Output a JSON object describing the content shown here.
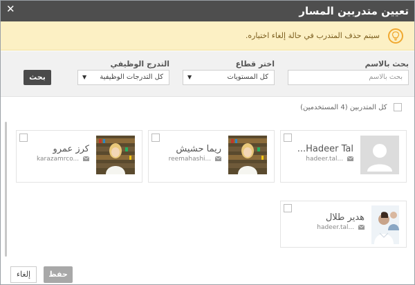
{
  "dialog": {
    "title": "تعيين متدربين المسار",
    "close_glyph": "✕"
  },
  "warning": {
    "icon": "lightbulb-icon",
    "message": "سيتم حذف المتدرب في حالة إلغاء اختياره."
  },
  "filters": {
    "name_search": {
      "label": "بحث بالاسم",
      "placeholder": "بحث بالاسم"
    },
    "sector": {
      "label": "اختر قطاع",
      "selected": "كل المستويات"
    },
    "grade": {
      "label": "التدرج الوظيفي",
      "selected": "كل التدرجات الوظيفية"
    },
    "search_button": "بحث"
  },
  "select_all": {
    "label": "كل المتدربين (4 المستخدمين)"
  },
  "trainees": [
    {
      "name": "Hadeer Tal...",
      "email": "hadeer.tal...",
      "photo": "placeholder-avatar"
    },
    {
      "name": "ريما حشيش",
      "email": "reemahashi...",
      "photo": "library-photo"
    },
    {
      "name": "كرز عمرو",
      "email": "karazamrco...",
      "photo": "library-photo"
    },
    {
      "name": "هدير طلال",
      "email": "hadeer.tal...",
      "photo": "person-photo"
    }
  ],
  "footer": {
    "save_label": "حفظ",
    "cancel_label": "إلغاء"
  },
  "colors": {
    "titlebar": "#4e4e4e",
    "warning_bg": "#fcf0c4",
    "filter_bg": "#f1f1f1",
    "search_btn": "#4a4a4a",
    "save_btn": "#a8a8a8"
  }
}
